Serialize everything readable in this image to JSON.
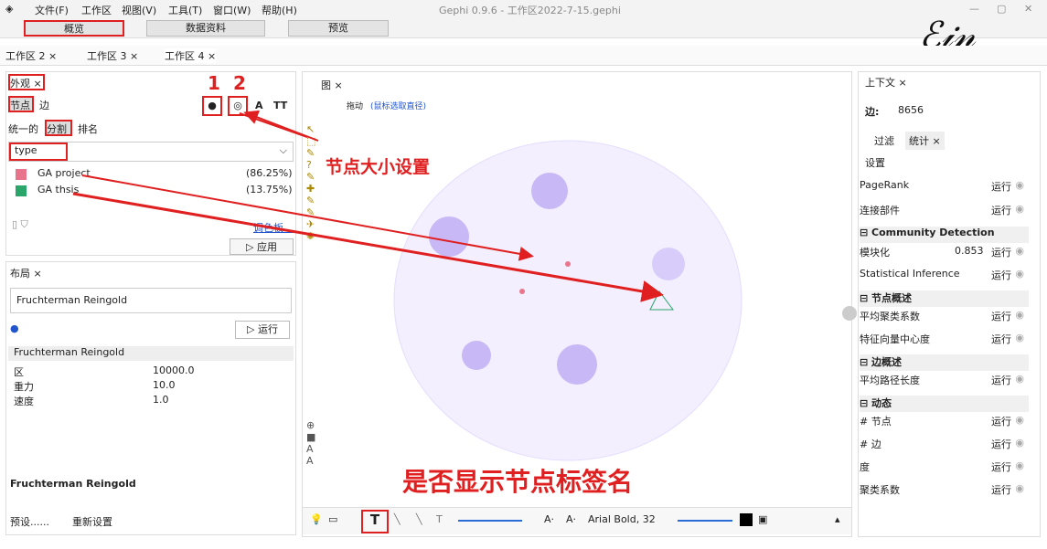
{
  "menu": {
    "items": [
      "文件(F)",
      "工作区",
      "视图(V)",
      "工具(T)",
      "窗口(W)",
      "帮助(H)"
    ],
    "title": "Gephi 0.9.6 - 工作区2022-7-15.gephi"
  },
  "modes": {
    "overview": "概览",
    "data": "数据资料",
    "preview": "预览"
  },
  "workspaces": [
    "工作区 2 ×",
    "工作区 3 ×",
    "工作区 4 ×"
  ],
  "appearance": {
    "tab": "外观 ×",
    "nodes": "节点",
    "edges": "边",
    "sub_unique": "统一的",
    "sub_partition": "分割",
    "sub_ranking": "排名",
    "attribute": "type",
    "parts": [
      {
        "label": "GA project",
        "pct": "(86.25%)",
        "color": "#e8758c"
      },
      {
        "label": "GA thsis",
        "pct": "(13.75%)",
        "color": "#2aa66a"
      }
    ],
    "palette": "调色板...",
    "apply": "▷ 应用",
    "marker1": "1",
    "marker2": "2"
  },
  "layout": {
    "tab": "布局 ×",
    "algorithm": "Fruchterman Reingold",
    "run": "▷ 运行",
    "section": "Fruchterman Reingold",
    "props": [
      {
        "k": "区",
        "v": "10000.0"
      },
      {
        "k": "重力",
        "v": "10.0"
      },
      {
        "k": "速度",
        "v": "1.0"
      }
    ],
    "footer_title": "Fruchterman Reingold",
    "preset": "预设......",
    "reset": "重新设置"
  },
  "graph": {
    "tab": "图 ×",
    "mode": "拖动",
    "hint": "(鼠标选取直径)",
    "font": "Arial Bold, 32"
  },
  "annotations": {
    "size": "节点大小设置",
    "labels": "是否显示节点标签名"
  },
  "context": {
    "tab": "上下文 ×",
    "edges_label": "边:",
    "edges_value": "8656"
  },
  "stats": {
    "filter_tab": "过滤",
    "stats_tab": "统计 ×",
    "settings": "设置",
    "rows": [
      {
        "label": "PageRank",
        "run": "运行"
      },
      {
        "label": "连接部件",
        "run": "运行"
      },
      {
        "section": "Community Detection"
      },
      {
        "label": "模块化",
        "value": "0.853",
        "run": "运行"
      },
      {
        "label": "Statistical Inference",
        "run": "运行"
      },
      {
        "section": "节点概述"
      },
      {
        "label": "平均聚类系数",
        "run": "运行"
      },
      {
        "label": "特征向量中心度",
        "run": "运行"
      },
      {
        "section": "边概述"
      },
      {
        "label": "平均路径长度",
        "run": "运行"
      },
      {
        "section": "动态"
      },
      {
        "label": "# 节点",
        "run": "运行"
      },
      {
        "label": "# 边",
        "run": "运行"
      },
      {
        "label": "度",
        "run": "运行"
      },
      {
        "label": "聚类系数",
        "run": "运行"
      }
    ]
  }
}
